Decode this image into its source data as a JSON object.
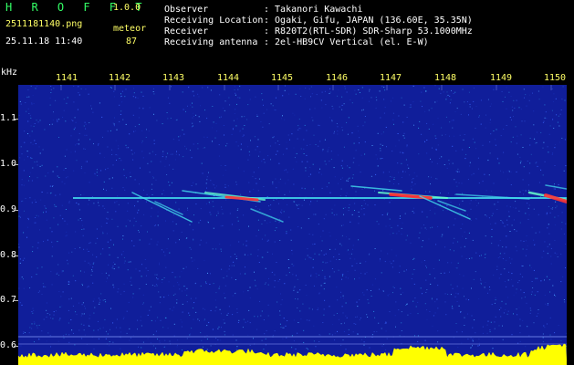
{
  "header": {
    "app_name": "H R O F F T",
    "version": "1.0.0",
    "filename": "2511181140.png",
    "datetime": "25.11.18 11:40",
    "detection_label": "meteor",
    "detection_count": "87",
    "info": [
      {
        "label": "Observer",
        "value": ": Takanori Kawachi"
      },
      {
        "label": "Receiving Location",
        "value": ": Ogaki, Gifu, JAPAN (136.60E, 35.35N)"
      },
      {
        "label": "Receiver",
        "value": ": R820T2(RTL-SDR) SDR-Sharp 53.1000MHz"
      },
      {
        "label": "Receiving antenna",
        "value": ": 2el-HB9CV Vertical (el. E-W)"
      }
    ]
  },
  "axis": {
    "unit": "kHz",
    "freq_ticks": [
      "1.1",
      "1.0",
      "0.9",
      "0.8",
      "0.7",
      "0.6"
    ],
    "time_ticks": [
      "1141",
      "1142",
      "1143",
      "1144",
      "1145",
      "1146",
      "1147",
      "1148",
      "1149",
      "1150"
    ]
  },
  "colors": {
    "background": "#000000",
    "spectrum_bg": "#101e9a",
    "text_white": "#ffffff",
    "text_yellow": "#ffff66",
    "title_green": "#33ff66",
    "signal_cyan": "#44ddee",
    "signal_red": "#ff3333",
    "noise_floor": "#ffff00"
  }
}
